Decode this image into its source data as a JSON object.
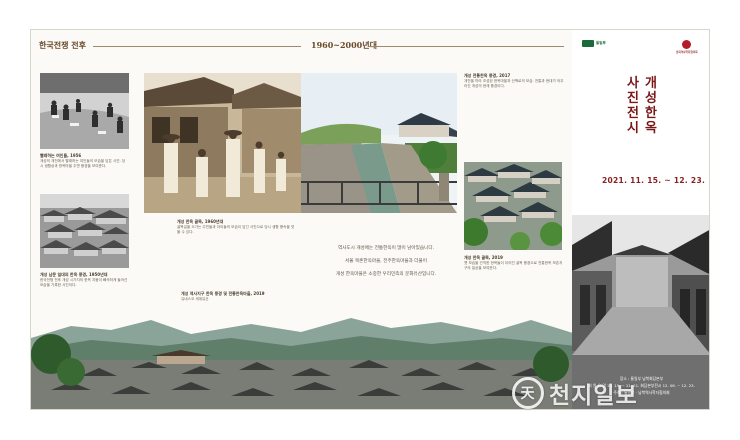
{
  "sections": {
    "left_title": "한국전쟁 전후",
    "middle_title": "1960~2000년대"
  },
  "captions": {
    "laundry": {
      "title": "빨래하는 여인들, 1956",
      "body": "개성의 개천에서 빨래하는 여인들의 모습을 담은 사진. 당시 생활상과 한옥마을 주변 풍경을 보여준다."
    },
    "aerial": {
      "title": "개성 남문 일대의 한옥 풍경, 1950년대",
      "body": "한국전쟁 전후 개성 시가지의 한옥 지붕이 빼곡하게 들어선 모습을 기록한 사진이다."
    },
    "street": {
      "title": "개성 한옥 골목, 1960년대",
      "body": "골목길을 오가는 주민들과 아이들의 모습이 담긴 사진으로 당시 생활 풍속을 엿볼 수 있다."
    },
    "bottom_left": {
      "title": "개성 역사지구 한옥 풍경 및 전통한옥마을, 2019",
      "body": "유네스코 세계유산"
    },
    "stream": {
      "title": "개성 전통한옥 풍경, 2017",
      "body": "개천을 따라 조성된 한옥마을과 산책로의 모습. 전통과 현대가 어우러진 개성의 현재 풍경이다."
    },
    "alley": {
      "title": "개성 한옥 골목, 2019",
      "body": "옛 모습을 간직한 한옥들이 이어진 골목 풍경으로 전통한옥 보존지구의 일상을 보여준다."
    }
  },
  "center_text": [
    "역사도시 개성에는 전통한옥이 많이 남아있습니다.",
    "서울 북촌한옥마을, 전주한옥마을과 더불어",
    "개성 한옥마을은 소중한 우리민족의 문화유산입니다."
  ],
  "cover": {
    "logo_left": "통일부",
    "logo_right": "남북역사학자협의회",
    "title_right": "개성한옥",
    "title_left": "사진전시",
    "date": "2021. 11. 15. ~ 12. 23.",
    "info": [
      "장소 : 통일부 남북회담본부",
      "회 원 유 역  11. 15. ~ 11. 21.    회담본부전시  12. 06. ~ 12. 23.",
      "주최 : 통일부 · 남북역사학자협의회"
    ]
  },
  "watermark": {
    "text": "천지일보",
    "icon_letter": "天"
  }
}
